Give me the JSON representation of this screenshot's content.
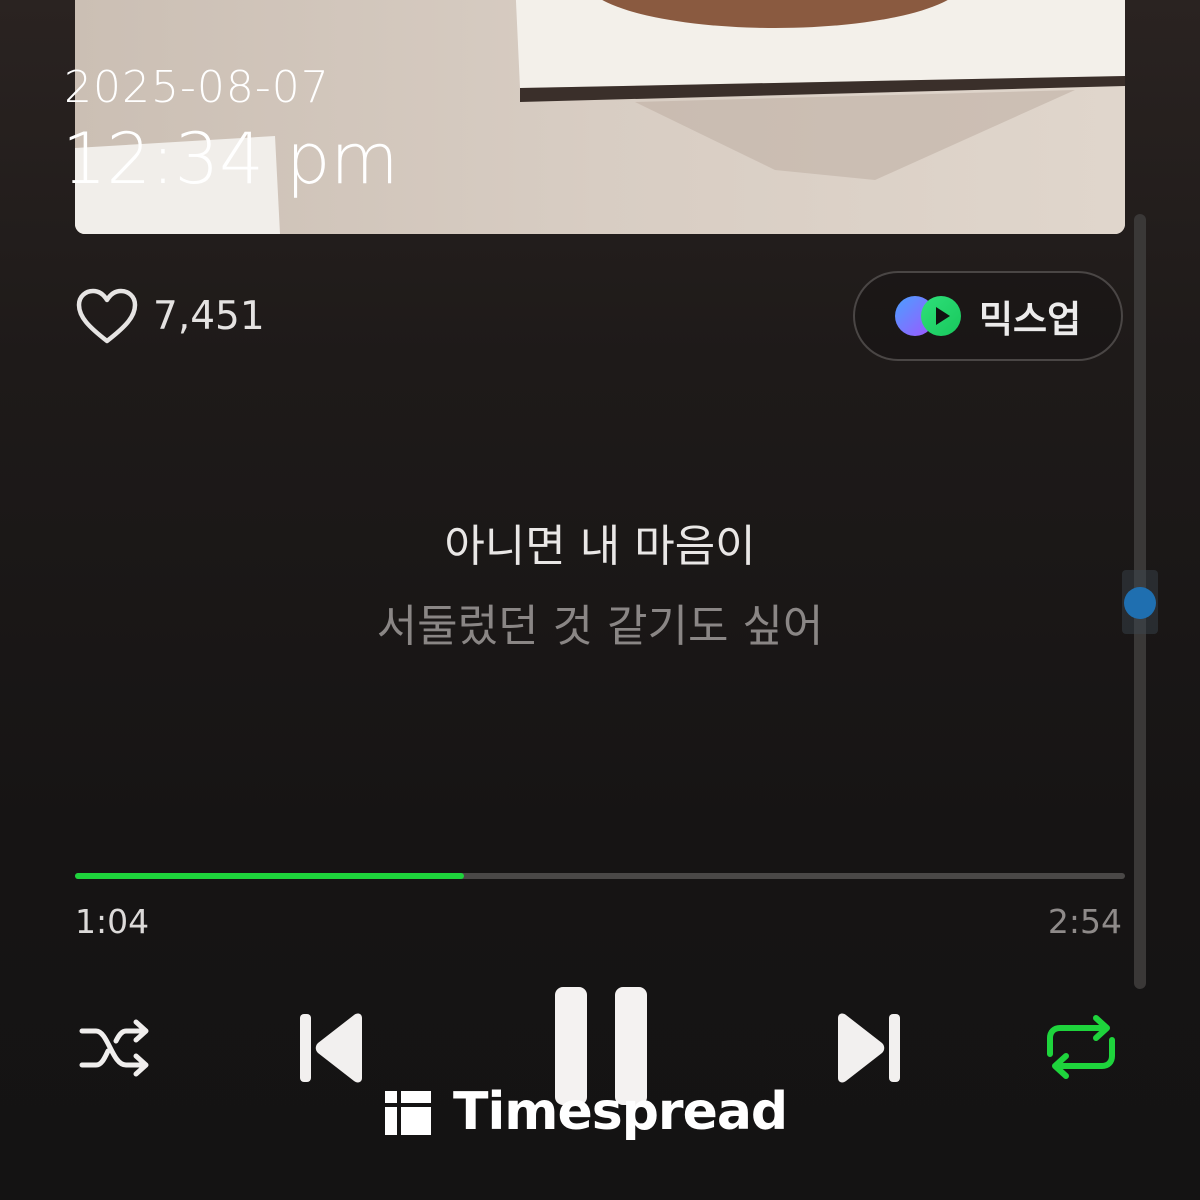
{
  "status": {
    "date": "2025-08-07",
    "time": "12:34 pm"
  },
  "album_art": {
    "icon": "album-cover-image"
  },
  "like": {
    "icon": "heart-outline-icon",
    "count": "7,451"
  },
  "mixup": {
    "icon": "mixup-icon",
    "label": "믹스업"
  },
  "lyrics": {
    "current": "아니면 내 마음이",
    "next": "서둘렀던 것 같기도 싶어"
  },
  "progress": {
    "elapsed": "1:04",
    "total": "2:54",
    "fraction": 0.37,
    "accent_color": "#1ed43c"
  },
  "scrollbar": {
    "thumb_color": "#1f6fb0",
    "position_fraction": 0.48
  },
  "controls": {
    "shuffle_icon": "shuffle-icon",
    "prev_icon": "skip-previous-icon",
    "play_pause_icon": "pause-icon",
    "next_icon": "skip-next-icon",
    "repeat_icon": "repeat-icon",
    "repeat_color": "#1ed43c"
  },
  "watermark": {
    "text": "Timespread"
  }
}
